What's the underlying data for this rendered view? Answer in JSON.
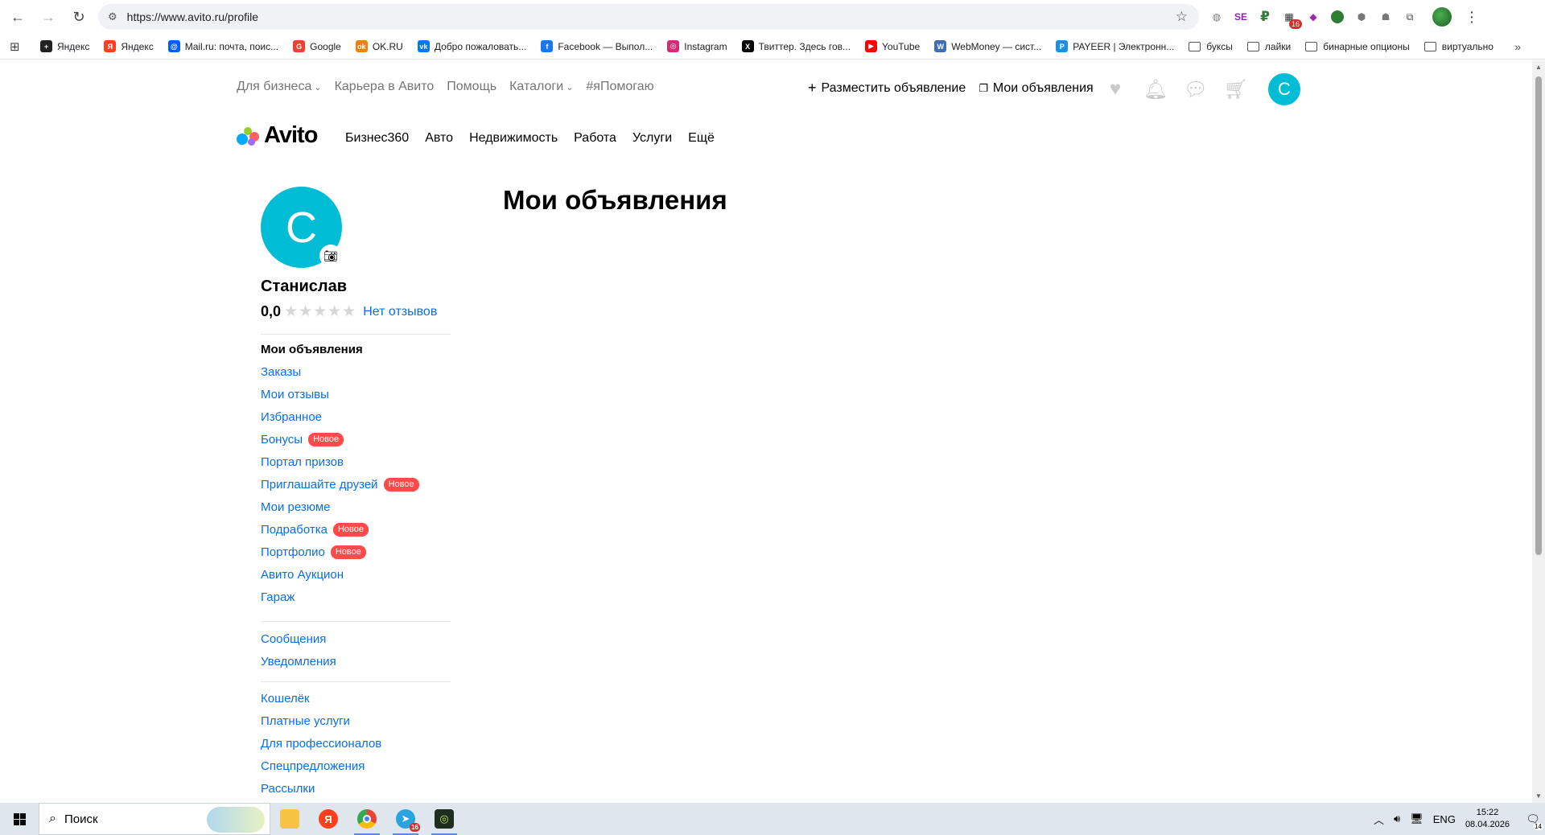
{
  "browser": {
    "url": "https://www.avito.ru/profile",
    "bookmarks": [
      {
        "label": "Яндекс",
        "icon": "yandex-plus-icon",
        "color": "#222222",
        "glyph": "+"
      },
      {
        "label": "Яндекс",
        "icon": "yandex-icon",
        "color": "#fc3f1d",
        "glyph": "Я"
      },
      {
        "label": "Mail.ru: почта, поис...",
        "icon": "mailru-icon",
        "color": "#005ff9",
        "glyph": "@"
      },
      {
        "label": "Google",
        "icon": "google-icon",
        "color": "#ea4335",
        "glyph": "G"
      },
      {
        "label": "OK.RU",
        "icon": "ok-icon",
        "color": "#ee8208",
        "glyph": "ok"
      },
      {
        "label": "Добро пожаловать...",
        "icon": "vk-icon",
        "color": "#0077ff",
        "glyph": "vk"
      },
      {
        "label": "Facebook — Выпол...",
        "icon": "facebook-icon",
        "color": "#1877f2",
        "glyph": "f"
      },
      {
        "label": "Instagram",
        "icon": "instagram-icon",
        "color": "#d62976",
        "glyph": "◎"
      },
      {
        "label": "Твиттер. Здесь гов...",
        "icon": "x-icon",
        "color": "#000000",
        "glyph": "X"
      },
      {
        "label": "YouTube",
        "icon": "youtube-icon",
        "color": "#ff0000",
        "glyph": "▶"
      },
      {
        "label": "WebMoney — сист...",
        "icon": "webmoney-icon",
        "color": "#3d6fb5",
        "glyph": "W"
      },
      {
        "label": "PAYEER | Электронн...",
        "icon": "payeer-icon",
        "color": "#1d8fe1",
        "glyph": "P"
      }
    ],
    "folders": [
      "буксы",
      "лайки",
      "бинарные опционы",
      "виртуально"
    ]
  },
  "header": {
    "top_links": [
      {
        "label": "Для бизнеса",
        "has_dropdown": true
      },
      {
        "label": "Карьера в Авито",
        "has_dropdown": false
      },
      {
        "label": "Помощь",
        "has_dropdown": false
      },
      {
        "label": "Каталоги",
        "has_dropdown": true
      },
      {
        "label": "#яПомогаю",
        "has_dropdown": false
      }
    ],
    "post_ad": "Разместить объявление",
    "my_ads": "Мои объявления",
    "avatar_letter": "С",
    "logo_text": "Avito",
    "nav": [
      "Бизнес360",
      "Авто",
      "Недвижимость",
      "Работа",
      "Услуги",
      "Ещё"
    ]
  },
  "profile": {
    "avatar_letter": "С",
    "name": "Станислав",
    "rating": "0,0",
    "reviews_link": "Нет отзывов",
    "menu_group1": [
      {
        "label": "Мои объявления",
        "active": true,
        "badge": ""
      },
      {
        "label": "Заказы",
        "active": false,
        "badge": ""
      },
      {
        "label": "Мои отзывы",
        "active": false,
        "badge": ""
      },
      {
        "label": "Избранное",
        "active": false,
        "badge": ""
      },
      {
        "label": "Бонусы",
        "active": false,
        "badge": "Новое"
      },
      {
        "label": "Портал призов",
        "active": false,
        "badge": ""
      },
      {
        "label": "Приглашайте друзей",
        "active": false,
        "badge": "Новое"
      },
      {
        "label": "Мои резюме",
        "active": false,
        "badge": ""
      },
      {
        "label": "Подработка",
        "active": false,
        "badge": "Новое"
      },
      {
        "label": "Портфолио",
        "active": false,
        "badge": "Новое"
      },
      {
        "label": "Авито Аукцион",
        "active": false,
        "badge": ""
      },
      {
        "label": "Гараж",
        "active": false,
        "badge": ""
      }
    ],
    "menu_group2": [
      {
        "label": "Сообщения",
        "active": false,
        "badge": ""
      },
      {
        "label": "Уведомления",
        "active": false,
        "badge": ""
      }
    ],
    "menu_group3": [
      {
        "label": "Кошелёк",
        "active": false,
        "badge": ""
      },
      {
        "label": "Платные услуги",
        "active": false,
        "badge": ""
      },
      {
        "label": "Для профессионалов",
        "active": false,
        "badge": ""
      },
      {
        "label": "Спецпредложения",
        "active": false,
        "badge": ""
      },
      {
        "label": "Рассылки",
        "active": false,
        "badge": ""
      }
    ]
  },
  "main": {
    "title": "Мои объявления"
  },
  "taskbar": {
    "search_placeholder": "Поиск",
    "lang": "ENG",
    "time": "15:22",
    "date": "08.04.2026",
    "notification_count": "14",
    "telegram_badge": "16"
  },
  "colors": {
    "avito_accent": "#00bcd4",
    "link": "#0a6fe0",
    "badge": "#ff4a4a"
  }
}
